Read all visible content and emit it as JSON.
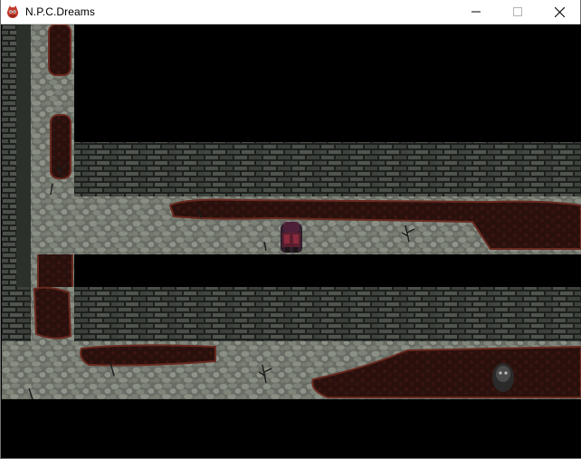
{
  "window": {
    "title": "N.P.C.Dreams",
    "icons": {
      "app": "red-creature-icon",
      "minimize": "minimize-icon",
      "maximize": "maximize-icon",
      "close": "close-icon"
    }
  },
  "scene": {
    "type": "top-down dungeon map",
    "palette": {
      "floor": "#6f736b",
      "floor_stone": "#8c9186",
      "brick_wall": "#3d423d",
      "brick_mortar": "#1c1f1c",
      "blood": "#2a0f0c",
      "blood_edge": "#6a2a20",
      "void": "#000000"
    }
  }
}
